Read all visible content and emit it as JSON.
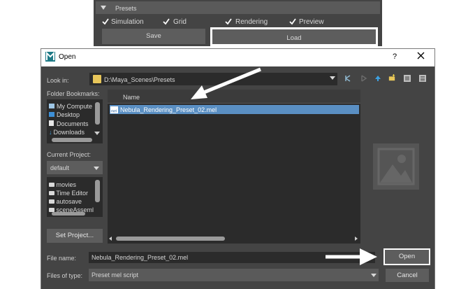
{
  "presets": {
    "title": "Presets",
    "checkboxes": [
      {
        "label": "Simulation",
        "checked": true
      },
      {
        "label": "Grid",
        "checked": true
      },
      {
        "label": "Rendering",
        "checked": true
      },
      {
        "label": "Preview",
        "checked": true
      }
    ],
    "save_label": "Save",
    "load_label": "Load"
  },
  "dialog": {
    "title": "Open",
    "help_label": "?",
    "close_label": "✕",
    "look_in_label": "Look in:",
    "look_in_path": "D:\\Maya_Scenes\\Presets",
    "folder_bookmarks_label": "Folder Bookmarks:",
    "bookmarks": [
      "My Compute",
      "Desktop",
      "Documents",
      "Downloads"
    ],
    "current_project_label": "Current Project:",
    "current_project_value": "default",
    "project_folders": [
      "movies",
      "Time Editor",
      "autosave",
      "sceneAsseml"
    ],
    "set_project_label": "Set Project...",
    "list_header_name": "Name",
    "files": [
      {
        "name": "Nebula_Rendering_Preset_02.mel",
        "selected": true
      }
    ],
    "file_name_label": "File name:",
    "file_name_value": "Nebula_Rendering_Preset_02.mel",
    "files_of_type_label": "Files of type:",
    "files_of_type_value": "Preset mel script",
    "open_label": "Open",
    "cancel_label": "Cancel"
  },
  "colors": {
    "panel_bg": "#444444",
    "field_bg": "#2b2b2b",
    "selection": "#5a8fc3",
    "highlight_box": "#ffffff"
  }
}
